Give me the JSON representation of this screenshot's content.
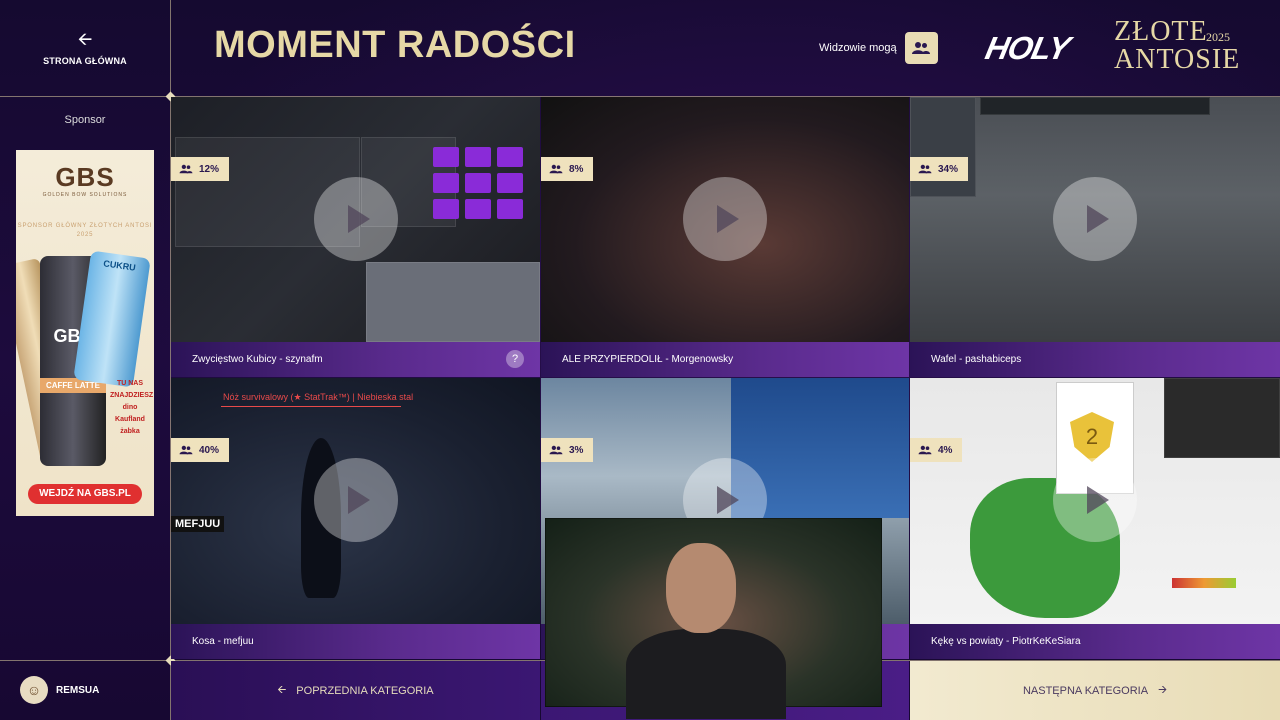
{
  "header": {
    "back_label": "STRONA GŁÓWNA",
    "title": "MOMENT RADOŚCI",
    "viewers_label": "Widzowie mogą",
    "logo_brand": "HOLY",
    "logo_name": "ZŁOTE ANTOSIE",
    "logo_year": "2025"
  },
  "sponsor": {
    "label": "Sponsor",
    "ad": {
      "brand": "GBS",
      "brand_sub": "GOLDEN BOW SOLUTIONS",
      "tagline": "SPONSOR GŁÓWNY ZŁOTYCH ANTOSI 2025",
      "can_label": "GBS",
      "can_flavor": "CAFFE LATTE",
      "can2_label": "CUKRU",
      "stores": "TU NAS ZNAJDZIESZ dino Kaufland żabka",
      "cta": "WEJDŹ NA GBS.PL"
    }
  },
  "tiles": [
    {
      "percent": "12%",
      "caption": "Zwycięstwo Kubicy - szynafm"
    },
    {
      "percent": "8%",
      "caption": "ALE PRZYPIERDOLIŁ - Morgenowsky"
    },
    {
      "percent": "34%",
      "caption": "Wafel - pashabiceps"
    },
    {
      "percent": "40%",
      "caption": "Kosa - mefjuu"
    },
    {
      "percent": "3%",
      "caption": ""
    },
    {
      "percent": "4%",
      "caption": "Kękę vs powiaty - PiotrKeKeSiara"
    }
  ],
  "tile_overlays": {
    "knife_title": "Nóż survivalowy (★ StatTrak™) | Niebieska stal",
    "mefjuu_tag": "MEFJUU",
    "shield_number": "2",
    "help": "?"
  },
  "footer": {
    "user_name": "REMSUA",
    "prev_label": "POPRZEDNIA KATEGORIA",
    "next_label": "NASTĘPNA KATEGORIA"
  },
  "colors": {
    "accent_gold": "#e6d8a6",
    "caption_purple": "#5a2b8d",
    "background": "#12082a"
  }
}
